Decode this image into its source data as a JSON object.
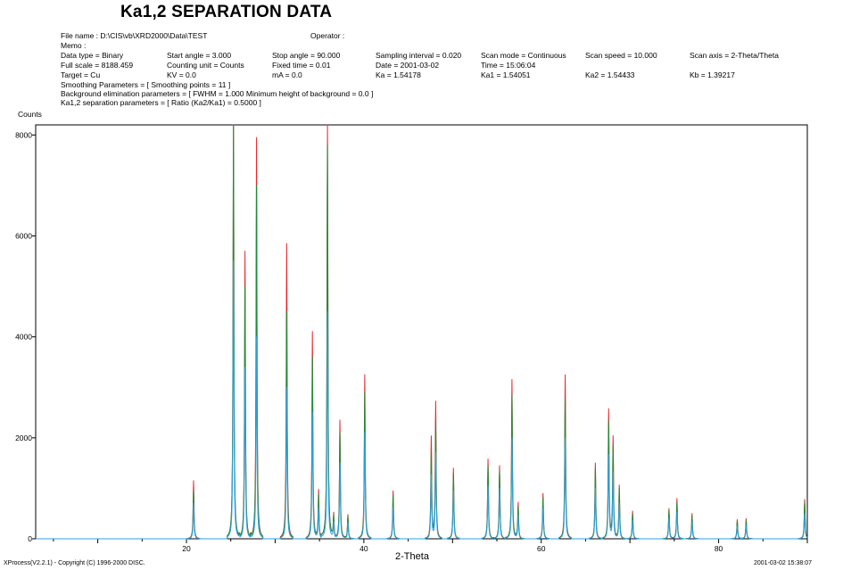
{
  "header": {
    "title": "Ka1,2 SEPARATION DATA",
    "file_name": "File name : D:\\CIS\\vb\\XRD2000\\Data\\TEST",
    "operator": "Operator :",
    "memo": "Memo :",
    "data_type": "Data type = Binary",
    "start_angle": "Start angle = 3.000",
    "stop_angle": "Stop angle = 90.000",
    "sampling_interval": "Sampling interval = 0.020",
    "scan_mode": "Scan mode = Continuous",
    "scan_speed": "Scan speed = 10.000",
    "scan_axis": "Scan axis = 2-Theta/Theta",
    "full_scale": "Full scale = 8188.459",
    "counting_unit": "Counting unit = Counts",
    "fixed_time": "Fixed time = 0.01",
    "date": "Date = 2001-03-02",
    "time": "Time = 15:06:04",
    "target": "Target = Cu",
    "kv": "KV  = 0.0",
    "ma": "mA  = 0.0",
    "ka": "Ka   = 1.54178",
    "ka1": "Ka1  = 1.54051",
    "ka2": "Ka2  = 1.54433",
    "kb": "Kb   = 1.39217",
    "smoothing": "Smoothing Parameters = [ Smoothing points = 11 ]",
    "background": "Background elimination parameters = [ FWHM = 1.000   Minimum height of background = 0.0 ]",
    "separation": "Ka1,2 separation parameters = [ Ratio (Ka2/Ka1) = 0.5000 ]"
  },
  "footer": {
    "copyright": "XProcess(V2.2.1) - Copyright (C) 1996-2000 DISC.",
    "timestamp": "2001-03-02   15:38:07"
  },
  "colors": {
    "raw": "#e8282c",
    "separated": "#1a8f3a",
    "ka1": "#2ca2e0",
    "axis": "#000000"
  },
  "chart_data": {
    "type": "line",
    "ylabel": "Counts",
    "xlabel": "2-Theta",
    "xlim": [
      3,
      90
    ],
    "ylim": [
      0,
      8200
    ],
    "x_ticks": [
      20,
      40,
      60,
      80
    ],
    "y_ticks": [
      0,
      2000,
      4000,
      6000,
      8000
    ],
    "grid": false,
    "series": [
      {
        "key": "raw",
        "color": "#e8282c",
        "peaks": [
          [
            20.8,
            1150
          ],
          [
            25.3,
            8200
          ],
          [
            26.6,
            5700
          ],
          [
            27.9,
            7950
          ],
          [
            31.3,
            5850
          ],
          [
            34.2,
            4100
          ],
          [
            34.9,
            950
          ],
          [
            35.9,
            8200
          ],
          [
            36.6,
            450
          ],
          [
            37.3,
            2350
          ],
          [
            38.2,
            480
          ],
          [
            40.1,
            3250
          ],
          [
            43.3,
            950
          ],
          [
            47.6,
            2000
          ],
          [
            48.1,
            2700
          ],
          [
            50.1,
            1400
          ],
          [
            54.0,
            1580
          ],
          [
            55.3,
            1450
          ],
          [
            56.7,
            3150
          ],
          [
            57.4,
            700
          ],
          [
            60.2,
            900
          ],
          [
            62.7,
            3250
          ],
          [
            66.1,
            1500
          ],
          [
            67.6,
            2550
          ],
          [
            68.1,
            2000
          ],
          [
            68.8,
            1050
          ],
          [
            70.3,
            550
          ],
          [
            74.4,
            600
          ],
          [
            75.3,
            800
          ],
          [
            77.0,
            500
          ],
          [
            82.1,
            380
          ],
          [
            83.1,
            400
          ],
          [
            89.7,
            780
          ]
        ]
      },
      {
        "key": "separated",
        "color": "#1a8f3a",
        "peaks": [
          [
            20.8,
            950
          ],
          [
            25.3,
            8200
          ],
          [
            26.6,
            5000
          ],
          [
            27.9,
            7000
          ],
          [
            31.3,
            4500
          ],
          [
            34.2,
            3600
          ],
          [
            34.9,
            850
          ],
          [
            35.9,
            7800
          ],
          [
            36.6,
            420
          ],
          [
            37.3,
            2100
          ],
          [
            38.2,
            440
          ],
          [
            40.1,
            2900
          ],
          [
            43.3,
            850
          ],
          [
            47.6,
            1700
          ],
          [
            48.1,
            2300
          ],
          [
            50.1,
            1300
          ],
          [
            54.0,
            1450
          ],
          [
            55.3,
            1350
          ],
          [
            56.7,
            2850
          ],
          [
            57.4,
            620
          ],
          [
            60.2,
            820
          ],
          [
            62.7,
            2800
          ],
          [
            66.1,
            1400
          ],
          [
            67.6,
            2300
          ],
          [
            68.1,
            1800
          ],
          [
            68.8,
            980
          ],
          [
            70.3,
            500
          ],
          [
            74.4,
            560
          ],
          [
            75.3,
            720
          ],
          [
            77.0,
            460
          ],
          [
            82.1,
            350
          ],
          [
            83.1,
            360
          ],
          [
            89.7,
            720
          ]
        ]
      },
      {
        "key": "ka1",
        "color": "#2ca2e0",
        "peaks": [
          [
            20.8,
            700
          ],
          [
            25.3,
            5500
          ],
          [
            26.6,
            3400
          ],
          [
            27.9,
            4000
          ],
          [
            31.3,
            3000
          ],
          [
            34.2,
            2500
          ],
          [
            34.9,
            600
          ],
          [
            35.9,
            4500
          ],
          [
            36.6,
            300
          ],
          [
            37.3,
            1500
          ],
          [
            38.2,
            320
          ],
          [
            40.1,
            2100
          ],
          [
            43.3,
            620
          ],
          [
            47.6,
            1250
          ],
          [
            48.1,
            1700
          ],
          [
            50.1,
            950
          ],
          [
            54.0,
            1050
          ],
          [
            55.3,
            1000
          ],
          [
            56.7,
            2000
          ],
          [
            57.4,
            450
          ],
          [
            60.2,
            600
          ],
          [
            62.7,
            2000
          ],
          [
            66.1,
            1000
          ],
          [
            67.6,
            1650
          ],
          [
            68.1,
            1300
          ],
          [
            68.8,
            700
          ],
          [
            70.3,
            360
          ],
          [
            74.4,
            400
          ],
          [
            75.3,
            520
          ],
          [
            77.0,
            330
          ],
          [
            82.1,
            250
          ],
          [
            83.1,
            260
          ],
          [
            89.7,
            500
          ]
        ]
      }
    ]
  }
}
